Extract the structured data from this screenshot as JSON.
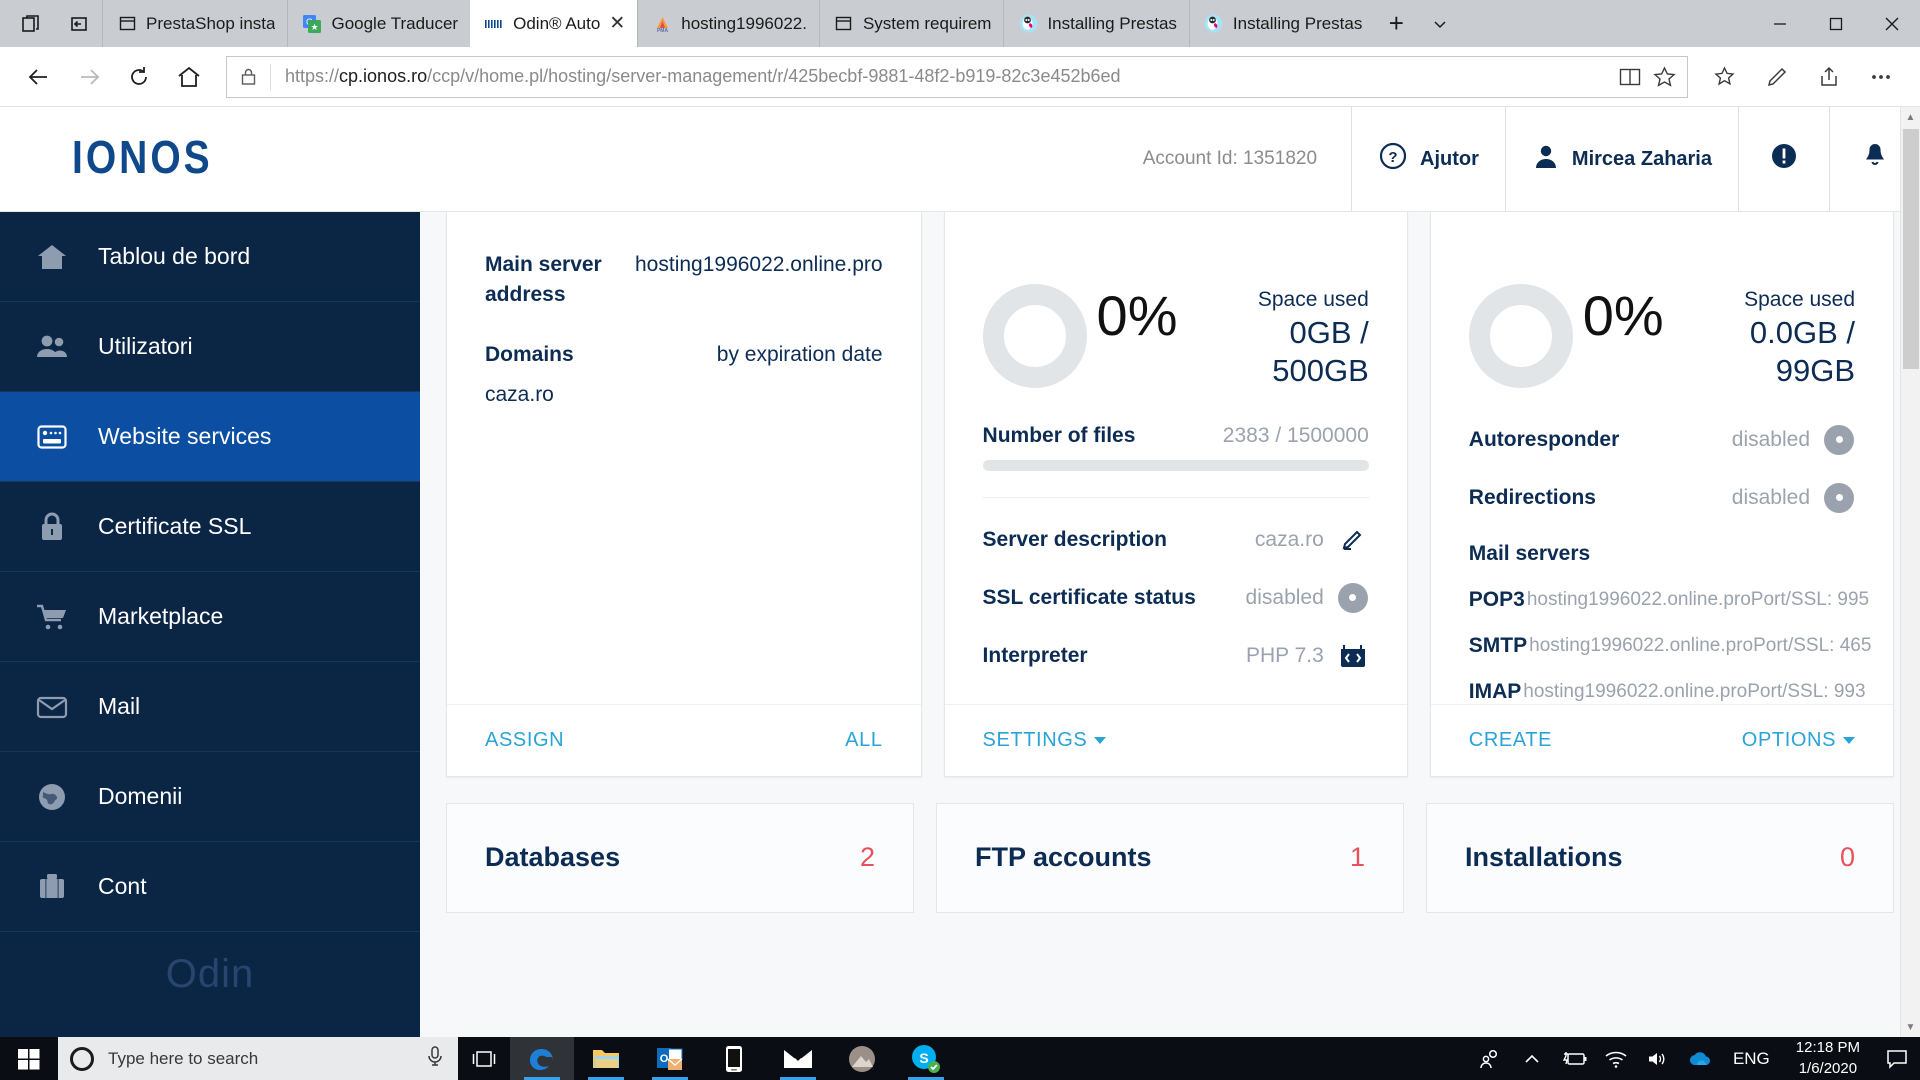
{
  "browser": {
    "window_controls": [
      "minimize",
      "maximize",
      "close"
    ],
    "tabs": [
      {
        "label": "PrestaShop insta",
        "icon": "window-icon",
        "active": false
      },
      {
        "label": "Google Traducer",
        "icon": "google-translate-icon",
        "active": false
      },
      {
        "label": "Odin® Auto",
        "icon": "ionos-icon",
        "active": true,
        "close": "✕"
      },
      {
        "label": "hosting1996022.",
        "icon": "phpmyadmin-icon",
        "active": false
      },
      {
        "label": "System requirem",
        "icon": "window-icon",
        "active": false
      },
      {
        "label": "Installing Prestas",
        "icon": "prestashop-icon",
        "active": false
      },
      {
        "label": "Installing Prestas",
        "icon": "prestashop-icon",
        "active": false
      }
    ],
    "new_tab_label": "+",
    "tab_menu_label": "⌄",
    "url_prefix": "https://",
    "url_host": "cp.ionos.ro",
    "url_path": "/ccp/v/home.pl/hosting/server-management/r/425becbf-9881-48f2-b919-82c3e452b6ed",
    "url_full": "https://cp.ionos.ro/ccp/v/home.pl/hosting/server-management/r/425becbf-9881-48f2-b919-82c3e452b6ed"
  },
  "header": {
    "logo": "IONOS",
    "account_id": "Account Id: 1351820",
    "help_label": "Ajutor",
    "user_name": "Mircea Zaharia"
  },
  "sidebar": {
    "brand": "Odin",
    "items": [
      {
        "label": "Tablou de bord",
        "icon": "home-icon",
        "active": false
      },
      {
        "label": "Utilizatori",
        "icon": "users-icon",
        "active": false
      },
      {
        "label": "Website services",
        "icon": "server-icon",
        "active": true
      },
      {
        "label": "Certificate SSL",
        "icon": "lock-icon",
        "active": false
      },
      {
        "label": "Marketplace",
        "icon": "cart-icon",
        "active": false
      },
      {
        "label": "Mail",
        "icon": "envelope-icon",
        "active": false
      },
      {
        "label": "Domenii",
        "icon": "globe-icon",
        "active": false
      },
      {
        "label": "Cont",
        "icon": "briefcase-icon",
        "active": false
      }
    ]
  },
  "cards": {
    "server": {
      "main_address_key": "Main server address",
      "main_address_value": "hosting1996022.online.pro",
      "domains_key": "Domains",
      "domains_sort": "by expiration date",
      "domain_list": "caza.ro",
      "footer_left": "ASSIGN",
      "footer_right": "ALL"
    },
    "webspace": {
      "space_used_label": "Space used",
      "percent": "0%",
      "size": "0GB / 500GB",
      "files_key": "Number of files",
      "files_value": "2383 / 1500000",
      "rows": [
        {
          "key": "Server description",
          "value": "caza.ro",
          "icon": "pencil-icon"
        },
        {
          "key": "SSL certificate status",
          "value": "disabled",
          "icon": "status-dot-icon"
        },
        {
          "key": "Interpreter",
          "value": "PHP 7.3",
          "icon": "code-icon"
        }
      ],
      "footer_left": "SETTINGS",
      "footer_left_caret": true
    },
    "mail": {
      "space_used_label": "Space used",
      "percent": "0%",
      "size": "0.0GB / 99GB",
      "rows": [
        {
          "key": "Autoresponder",
          "value": "disabled",
          "icon": "status-dot-icon"
        },
        {
          "key": "Redirections",
          "value": "disabled",
          "icon": "status-dot-icon"
        }
      ],
      "servers_title": "Mail servers",
      "servers": [
        {
          "proto": "POP3",
          "host": "hosting1996022.online.pro",
          "port": "Port/SSL: 995"
        },
        {
          "proto": "SMTP",
          "host": "hosting1996022.online.pro",
          "port": "Port/SSL: 465"
        },
        {
          "proto": "IMAP",
          "host": "hosting1996022.online.pro",
          "port": "Port/SSL: 993"
        }
      ],
      "footer_left": "CREATE",
      "footer_right": "OPTIONS",
      "footer_right_caret": true
    },
    "bottom": [
      {
        "title": "Databases",
        "count": "2"
      },
      {
        "title": "FTP accounts",
        "count": "1"
      },
      {
        "title": "Installations",
        "count": "0"
      }
    ]
  },
  "chart_data": [
    {
      "type": "pie",
      "title": "Space used",
      "categories": [
        "used",
        "free"
      ],
      "values": [
        0,
        500
      ],
      "unit": "GB",
      "percent_used": 0,
      "label": "0%",
      "detail": "0GB / 500GB"
    },
    {
      "type": "pie",
      "title": "Space used",
      "categories": [
        "used",
        "free"
      ],
      "values": [
        0.0,
        99
      ],
      "unit": "GB",
      "percent_used": 0,
      "label": "0%",
      "detail": "0.0GB / 99GB"
    },
    {
      "type": "bar",
      "title": "Number of files",
      "categories": [
        "files"
      ],
      "values": [
        2383
      ],
      "max": 1500000,
      "label": "2383 / 1500000"
    }
  ],
  "colors": {
    "ionos_blue": "#10488c",
    "sidebar_bg": "#0b2545",
    "sidebar_active": "#0b4ea2",
    "link": "#2aa3d8",
    "count_red": "#e8505b",
    "muted": "#9aa3ad"
  },
  "taskbar": {
    "search_placeholder": "Type here to search",
    "apps": [
      {
        "name": "microsoft-edge",
        "active": true
      },
      {
        "name": "file-explorer",
        "active": false
      },
      {
        "name": "outlook",
        "active": false
      },
      {
        "name": "your-phone",
        "active": false
      },
      {
        "name": "mail",
        "active": false
      },
      {
        "name": "photos",
        "active": false
      },
      {
        "name": "skype",
        "active": false
      }
    ],
    "language": "ENG",
    "time": "12:18 PM",
    "date": "1/6/2020"
  }
}
